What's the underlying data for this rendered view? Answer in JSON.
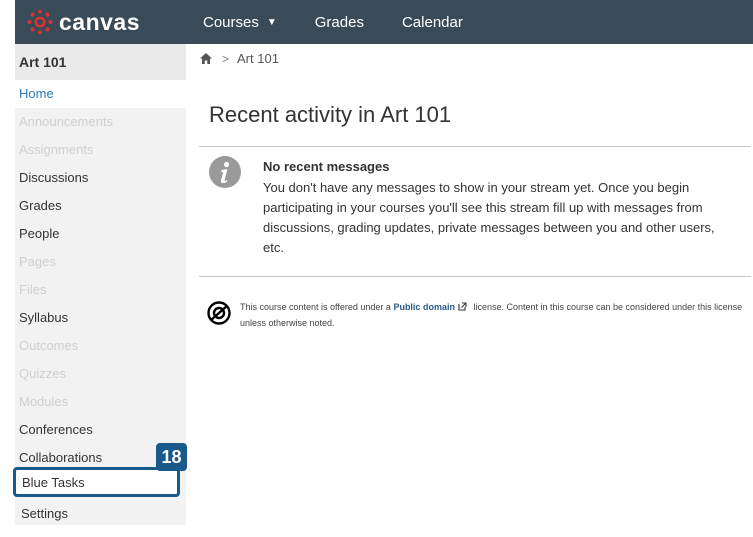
{
  "header": {
    "logo_text": "canvas",
    "nav": [
      {
        "label": "Courses"
      },
      {
        "label": "Grades"
      },
      {
        "label": "Calendar"
      }
    ]
  },
  "sidebar": {
    "course_title": "Art 101",
    "items": [
      {
        "label": "Home",
        "state": "active"
      },
      {
        "label": "Announcements",
        "state": "disabled"
      },
      {
        "label": "Assignments",
        "state": "disabled"
      },
      {
        "label": "Discussions",
        "state": "normal"
      },
      {
        "label": "Grades",
        "state": "normal"
      },
      {
        "label": "People",
        "state": "normal"
      },
      {
        "label": "Pages",
        "state": "disabled"
      },
      {
        "label": "Files",
        "state": "disabled"
      },
      {
        "label": "Syllabus",
        "state": "normal"
      },
      {
        "label": "Outcomes",
        "state": "disabled"
      },
      {
        "label": "Quizzes",
        "state": "disabled"
      },
      {
        "label": "Modules",
        "state": "disabled"
      },
      {
        "label": "Conferences",
        "state": "normal"
      },
      {
        "label": "Collaborations",
        "state": "normal"
      },
      {
        "label": "Blue Tasks",
        "state": "highlighted"
      },
      {
        "label": "Settings",
        "state": "normal"
      }
    ],
    "badge": "18"
  },
  "breadcrumb": {
    "current": "Art 101"
  },
  "main": {
    "title": "Recent activity in Art 101",
    "message_title": "No recent messages",
    "message_body": "You don't have any messages to show in your stream yet. Once you begin participating in your courses you'll see this stream fill up with messages from discussions, grading updates, private messages between you and other users, etc.",
    "license_prefix": "This course content is offered under a",
    "license_link": "Public domain",
    "license_suffix": "license. Content in this course can be considered under this license unless otherwise noted."
  },
  "colors": {
    "header_bg": "#394b58",
    "link": "#2a7bbc",
    "highlight": "#1a5a8a",
    "logo_red": "#e0312e"
  }
}
